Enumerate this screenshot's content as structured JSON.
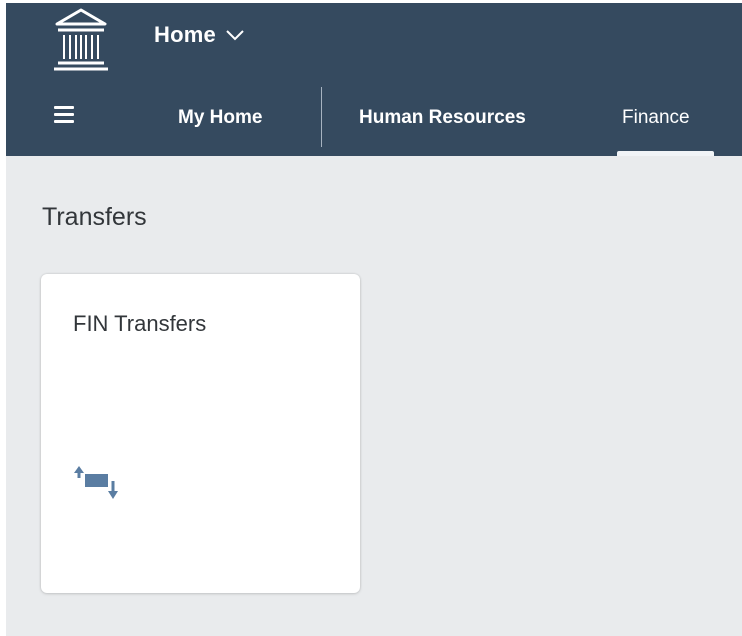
{
  "header": {
    "title": "Home",
    "logo_icon": "bank-building-icon",
    "title_menu_icon": "chevron-down-icon"
  },
  "nav": {
    "menu_icon": "hamburger-menu-icon",
    "tabs": [
      {
        "label": "My Home"
      },
      {
        "label": "Human Resources"
      },
      {
        "label": "Finance",
        "selected": true
      }
    ]
  },
  "section": {
    "title": "Transfers"
  },
  "tiles": [
    {
      "title": "FIN Transfers",
      "icon": "transfer-icon"
    }
  ],
  "colors": {
    "shell_background": "#354a5f",
    "page_background": "#e9ebed",
    "tile_icon": "#5a7da2"
  }
}
